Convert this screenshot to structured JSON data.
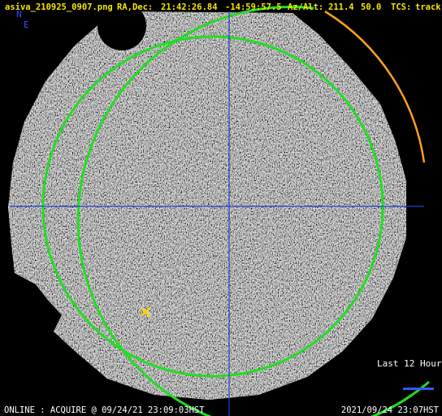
{
  "header": {
    "filename": "asiva_210925_0907.png",
    "radec_label": "RA,Dec:",
    "ra": "21:42:26.84",
    "dec": "-14:59:57.5",
    "azalt_label": "Az/Alt:",
    "az": "211.4",
    "alt": "50.0",
    "tcs_label": "TCS:",
    "tcs_state": "track"
  },
  "compass": {
    "north": "N",
    "east": "E"
  },
  "legend": {
    "label": "Last 12 Hours",
    "color": "#2a5cff"
  },
  "footer": {
    "status": "ONLINE : ACQUIRE @ 09/24/21 23:09:03HST",
    "timestamp": "2021/09/24 23:07HST"
  },
  "colors": {
    "header_text": "#f5e600",
    "horizon_circle": "#22dd22",
    "elevation_circle": "#22dd22",
    "crosshair": "#2040d0",
    "track_arc": "#ffa020",
    "target_marker": "#ffd400"
  },
  "icons": {
    "target": "x-marker-icon"
  }
}
